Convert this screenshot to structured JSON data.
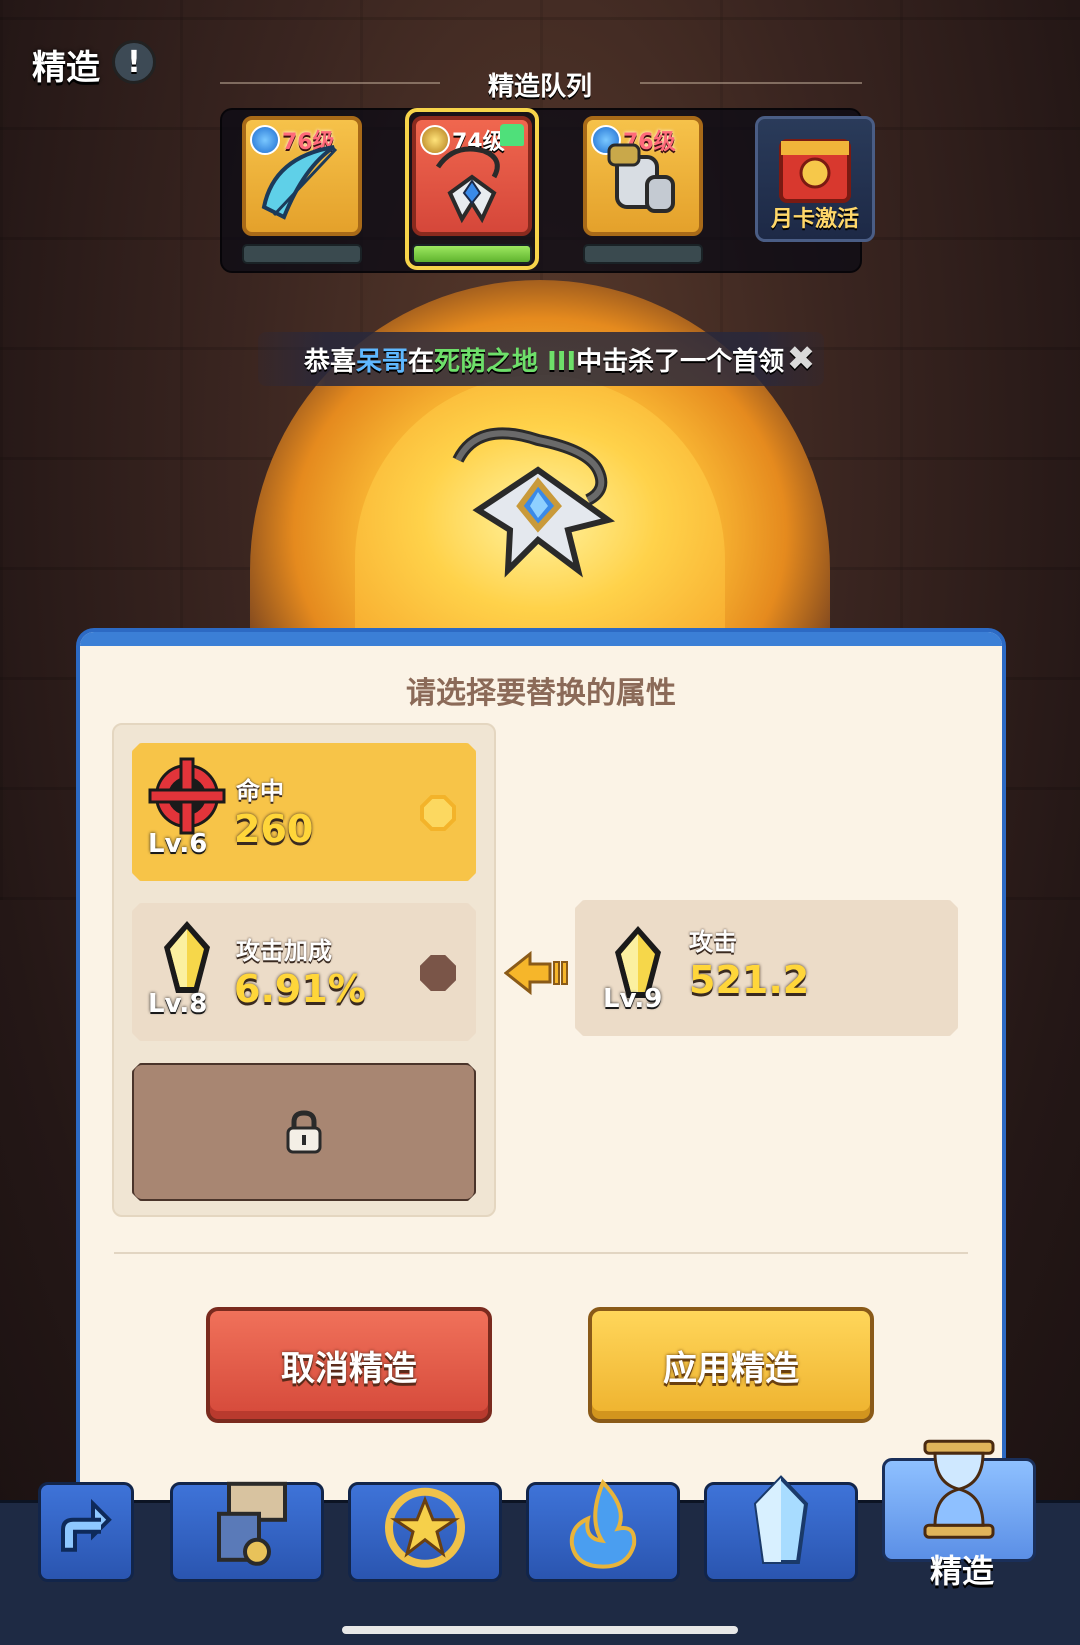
{
  "header": {
    "title": "精造",
    "info_icon": "exclamation-icon"
  },
  "queue": {
    "title": "精造队列",
    "slots": [
      {
        "level": "76级",
        "element": "water-swirl-icon",
        "item": "bow-icon",
        "progress": 0
      },
      {
        "level": "74级",
        "element": "sword-icon",
        "item": "amulet-icon",
        "progress": 1,
        "selected": true,
        "badge": "shirt-icon"
      },
      {
        "level": "76级",
        "element": "water-swirl-icon",
        "item": "gauntlet-icon",
        "progress": 0
      },
      {
        "label": "月卡激活",
        "item": "monthly-card-icon"
      }
    ]
  },
  "notice": {
    "parts": [
      "恭喜",
      "呆哥",
      "在",
      "死荫之地 III",
      "中击杀了一个首领"
    ],
    "close_icon": "close-icon"
  },
  "panel": {
    "heading": "请选择要替换的属性",
    "attributes": [
      {
        "name": "命中",
        "value": "260",
        "level": "Lv.6",
        "icon": "crosshair-icon",
        "selected": true
      },
      {
        "name": "攻击加成",
        "value": "6.91%",
        "level": "Lv.8",
        "icon": "attack-gem-icon",
        "selected": false
      },
      {
        "locked": true,
        "icon": "lock-icon"
      }
    ],
    "new_attribute": {
      "name": "攻击",
      "value": "521.2",
      "level": "Lv.9",
      "icon": "attack-gem-icon"
    },
    "arrow_icon": "arrow-left-icon"
  },
  "buttons": {
    "cancel": "取消精造",
    "apply": "应用精造"
  },
  "nav": {
    "items": [
      {
        "icon": "back-arrow-icon"
      },
      {
        "icon": "anvil-icon"
      },
      {
        "icon": "star-refresh-icon"
      },
      {
        "icon": "blue-flame-icon"
      },
      {
        "icon": "crystal-icon"
      },
      {
        "icon": "hourglass-icon",
        "label": "精造",
        "active": true
      }
    ]
  },
  "colors": {
    "accent_blue": "#3b7fd6",
    "gold": "#f7c448",
    "cancel_red": "#d5493a"
  }
}
